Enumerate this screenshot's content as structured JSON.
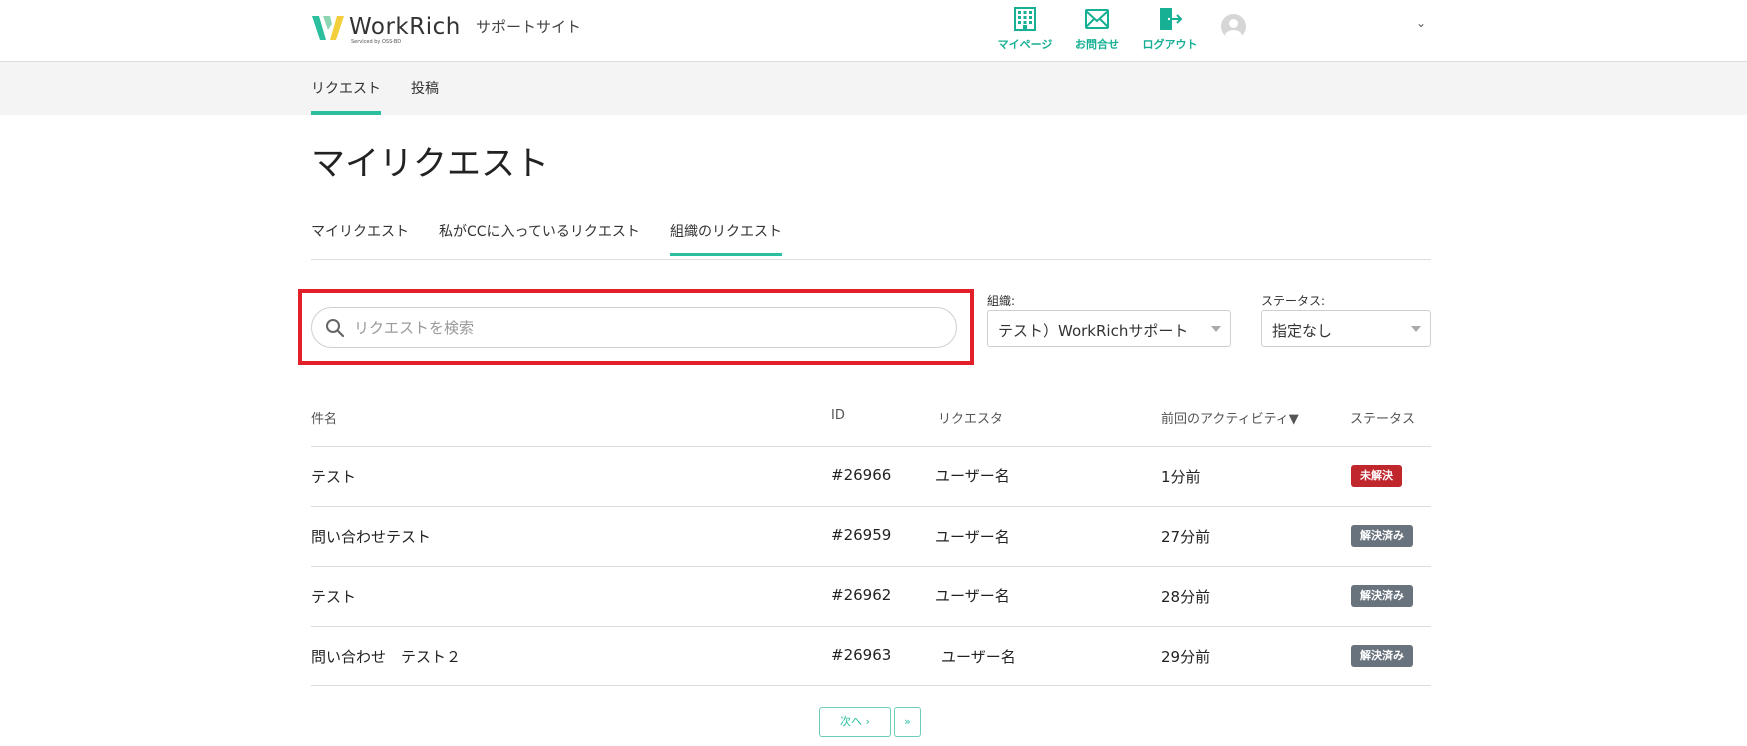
{
  "header": {
    "logo_text": "WorkRich",
    "logo_sub": "Serviced by OSS-BD",
    "site_name": "サポートサイト",
    "nav": [
      {
        "label": "マイページ",
        "icon": "building-icon"
      },
      {
        "label": "お問合せ",
        "icon": "mail-icon"
      },
      {
        "label": "ログアウト",
        "icon": "logout-door-icon"
      }
    ],
    "chevron": "⌄"
  },
  "subnav": {
    "items": [
      "リクエスト",
      "投稿"
    ],
    "active": "リクエスト"
  },
  "page_title": "マイリクエスト",
  "tabs": {
    "items": [
      "マイリクエスト",
      "私がCCに入っているリクエスト",
      "組織のリクエスト"
    ],
    "active": "組織のリクエスト"
  },
  "search": {
    "placeholder": "リクエストを検索",
    "value": ""
  },
  "filters": {
    "org": {
      "label": "組織:",
      "value": "テスト）WorkRichサポート"
    },
    "status": {
      "label": "ステータス:",
      "value": "指定なし"
    }
  },
  "table": {
    "headers": [
      "件名",
      "ID",
      "リクエスタ",
      "前回のアクティビティ▼",
      "ステータス"
    ],
    "rows": [
      {
        "subject": "テスト",
        "id": "#26966",
        "requester": "ユーザー名",
        "activity": "1分前",
        "status": "未解決"
      },
      {
        "subject": "問い合わせテスト",
        "id": "#26959",
        "requester": "ユーザー名",
        "activity": "27分前",
        "status": "解決済み"
      },
      {
        "subject": "テスト",
        "id": "#26962",
        "requester": "ユーザー名",
        "activity": "28分前",
        "status": "解決済み"
      },
      {
        "subject": "問い合わせ　テスト２",
        "id": "#26963",
        "requester": "ユーザー名",
        "activity": "29分前",
        "status": "解決済み"
      }
    ]
  },
  "pagination": {
    "next_label": "次へ ›",
    "last_label": "»"
  },
  "colors": {
    "accent": "#2bbf9f",
    "icon_green": "#17b094",
    "status_open": "#c0272d",
    "status_solved": "#68737d",
    "highlight_red": "#e1202a"
  }
}
